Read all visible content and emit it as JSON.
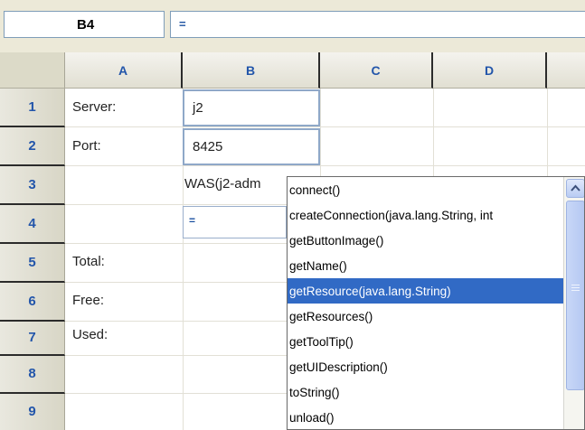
{
  "formula_bar": {
    "name_box": "B4",
    "formula": "="
  },
  "columns": [
    "A",
    "B",
    "C",
    "D"
  ],
  "rows": [
    "1",
    "2",
    "3",
    "4",
    "5",
    "6",
    "7",
    "8",
    "9"
  ],
  "cells": {
    "A1": "Server:",
    "B1": "j2",
    "A2": "Port:",
    "B2": "8425",
    "B3": "WAS(j2-adm",
    "B4": "=",
    "A5": "Total:",
    "A6": "Free:",
    "A7": "Used:"
  },
  "autocomplete": {
    "items": [
      "connect()",
      "createConnection(java.lang.String, int",
      "getButtonImage()",
      "getName()",
      "getResource(java.lang.String)",
      "getResources()",
      "getToolTip()",
      "getUIDescription()",
      "toString()",
      "unload()"
    ],
    "selected_index": 4
  },
  "icons": {
    "scroll_up": "chevron-up-icon"
  },
  "colors": {
    "selection": "#316ac5",
    "header_text": "#2255aa"
  }
}
